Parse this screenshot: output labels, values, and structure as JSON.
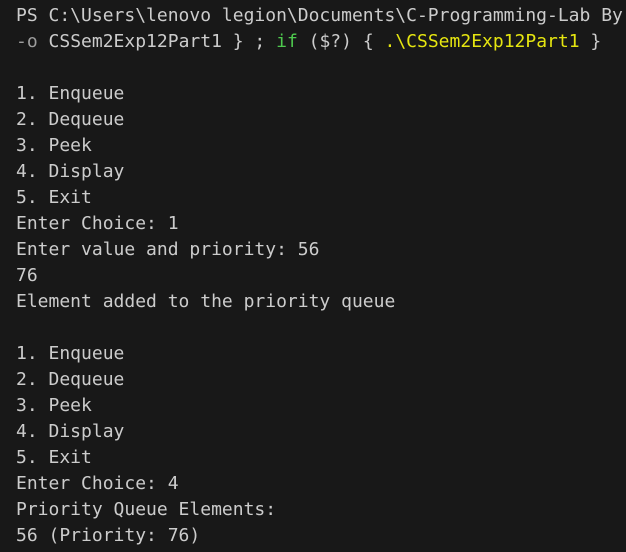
{
  "terminal": {
    "prompt_line": "PS C:\\Users\\lenovo legion\\Documents\\C-Programming-Lab By",
    "command": {
      "flag": "-o",
      "target": " CSSem2Exp12Part1 } ; ",
      "keyword": "if",
      "condition": " ($?) { ",
      "executable": ".\\CSSem2Exp12Part1",
      "closing": " }"
    },
    "output_lines": [
      "",
      "1. Enqueue",
      "2. Dequeue",
      "3. Peek",
      "4. Display",
      "5. Exit",
      "Enter Choice: 1",
      "Enter value and priority: 56",
      "76",
      "Element added to the priority queue",
      "",
      "1. Enqueue",
      "2. Dequeue",
      "3. Peek",
      "4. Display",
      "5. Exit",
      "Enter Choice: 4",
      "Priority Queue Elements:",
      "56 (Priority: 76)"
    ]
  },
  "colors": {
    "background": "#181818",
    "text": "#cccccc",
    "flag": "#9d9d9d",
    "keyword": "#4ec94e",
    "executable": "#e5e510"
  }
}
